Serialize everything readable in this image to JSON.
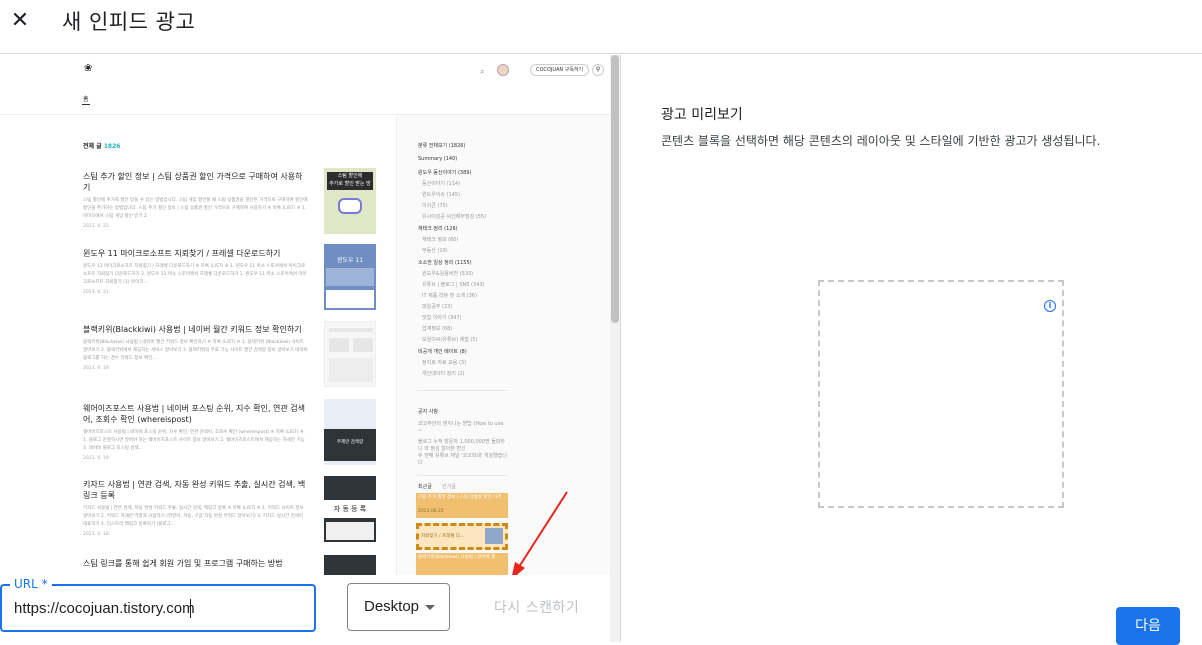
{
  "header": {
    "close_icon": "close-icon",
    "title": "새 인피드 광고"
  },
  "preview_site": {
    "logo_icon": "blog-logo-icon",
    "search_icon": "search-icon",
    "subscribe_label": "COCOJUAN 구독하기",
    "home_tab": "홈",
    "post_count_label": "전체 글",
    "post_count": "1826",
    "posts": [
      {
        "title": "스팀 추가 할인 정보 | 스팀 상품권 할인 가격으로 구매하여 사용하기",
        "excerpt": "스팀 할인에 추가로 할인 받을 수 있는 방법입니다. 스팀 게임 할인할 때 스팀 상품권을 할인된 가격으로 구매하여 할인에 할인을 추가하는 방법입니다. 스팀 추가 할인 정보 | 스팀 상품권 할인 가격으로 구매하여 사용하기 ※ 목록 (LIST) ※ 1. 이마오에서 스팀 게임 할인 받기 2.",
        "date": "2023. 6. 22."
      },
      {
        "title": "윈도우 11 마이크로소프트 지뢰찾기 / 프레셀 다운로드하기",
        "excerpt": "윈도우 11 마이크로소프트 지뢰찾기 / 프레셀 다운로드하기 ※ 목록 (LIST) ※ 1. 윈도우 11 마소 스토어에서 마이크로소프트 지뢰찾기 다운로드하기 2. 윈도우 11 마소 스토어에서 프레셀 다운로드하기 1. 윈도우 11 마소 스토어에서 마이크로소프트 지뢰찾기 (1) 마이크...",
        "date": "2023. 6. 21."
      },
      {
        "title": "블랙키위(Blackkiwi) 사용법 | 네이버 월간 키워드 정보 확인하기",
        "excerpt": "블랙키위(Blackkiwi) 사용법 | 네이버 월간 키워드 정보 확인하기 ※ 목록 (LIST) ※ 1. 블랙키위 (Blackkiwi) 사이트 알아보기 2. 블랙키위에서 제공하는 서비스 알아보기 3. 블랙키위의 무료 기능 사이트 월간 검색량 정보 알아보기 네이버 블로그를 하는 경우 키워드 정보 확인...",
        "date": "2023. 6. 19."
      },
      {
        "title": "웨어이즈포스트 사용법 | 네이버 포스팅 순위, 지수 확인, 연관 검색어, 조회수 확인 (whereispost)",
        "excerpt": "웨어이즈포스트 사용법 | 네이버 포스팅 순위, 지수 확인, 연관 검색어, 조회수 확인 (whereispost) ※ 목록 (LIST) ※ 1. 블로그 운영하시면 알아야 하는 웨어이즈포스트 사이트 정보 알아보기 2. 웨어이즈포스트에서 제공하는 자세한 기능 3. 네이버 블로그 포스팅 검색...",
        "date": "2023. 6. 19."
      },
      {
        "title": "키자드 사용법 | 연관 검색, 자동 완성 키워드 추출, 실시간 검색, 백링크 등록",
        "excerpt": "키자드 사용법 | 연관 검색, 자동 완성 키워드 추출, 실시간 검색, 백링크 등록 ※ 목록 (LIST) ※ 1. 키워드 사이트 정보 알아보기 2. 키워드 자세한 역할과 사용하기 (연관어, 자동, 구글 자동 완성 키워드 알아보기) 3. 키자드 실시간 검색어 대표하기 4. 티스토리 백링크 등록하기 (블로그...",
        "date": "2023. 6. 18."
      },
      {
        "title": "스팀 링크를 통해 쉽게 회원 가입 및 프로그램 구매하는 방법",
        "excerpt": "",
        "date": ""
      }
    ],
    "thumb_texts": [
      "스팀 할인에",
      "추가로 할인 받는 방",
      "윈도우 11",
      "자 동 등 록",
      "주제란 검색량"
    ],
    "sidebar": {
      "items": [
        {
          "label": "분류 전체보기 (1826)",
          "kind": "head"
        },
        {
          "label": "Summary (140)",
          "kind": "head"
        },
        {
          "label": "윈도우 동산이야기 (389)",
          "kind": "head"
        },
        {
          "label": "동산이야기 (114)",
          "kind": "sub"
        },
        {
          "label": "윈도우이슈 (145)",
          "kind": "sub"
        },
        {
          "label": "이이콘 (75)",
          "kind": "sub"
        },
        {
          "label": "유시이성공 씨인해무털성 (55)",
          "kind": "sub"
        },
        {
          "label": "재테크 정리 (126)",
          "kind": "head"
        },
        {
          "label": "재테크 정보 (60)",
          "kind": "sub"
        },
        {
          "label": "부동산 (19)",
          "kind": "sub"
        },
        {
          "label": "소소한 일상 정리 (1155)",
          "kind": "head"
        },
        {
          "label": "윈도우&응용버전 (533)",
          "kind": "sub"
        },
        {
          "label": "유튜브 | 블로그 | SNS (343)",
          "kind": "sub"
        },
        {
          "label": "IT 제품 리뷰 및 소개 (36)",
          "kind": "sub"
        },
        {
          "label": "파일공부 (23)",
          "kind": "sub"
        },
        {
          "label": "맛집 이야기 (347)",
          "kind": "sub"
        },
        {
          "label": "업계정보 (68)",
          "kind": "sub"
        },
        {
          "label": "모임이씨(유튜브) 체험 (5)",
          "kind": "sub"
        },
        {
          "label": "비공개 개인 메이트 (8)",
          "kind": "head"
        },
        {
          "label": "정치로 자료 모음 (3)",
          "kind": "sub"
        },
        {
          "label": "개인데이터 정리 (2)",
          "kind": "sub"
        }
      ],
      "notice_head": "공지 사항",
      "notices": [
        "코코주안의 엔지니는 방법 (How to use ~",
        "블로그 누적 방문자 1,000,000명 돌파하니 와 정성 알아본 변신",
        "두 번째 유튜브 채널 '코코피네' 개설했습니다"
      ],
      "recent_tabs": [
        "최근글",
        "인기글"
      ],
      "recent": [
        "스팀 추가 할인 정보 | 스팀 상품권 할인 가격 ...",
        "2023.06.22",
        "지뢰찾기 / 프레셀 다...",
        "블랙키위(Blackkiwi) 사용법 | 네이버 월 ..."
      ]
    }
  },
  "controls": {
    "url_label": "URL *",
    "url_value": "https://cocojuan.tistory.com",
    "device_select": "Desktop",
    "rescan_label": "다시 스캔하기"
  },
  "preview": {
    "title": "광고 미리보기",
    "description": "콘텐츠 블록을 선택하면 해당 콘텐츠의 레이아웃 및 스타일에 기반한 광고가 생성됩니다.",
    "info_icon": "info-icon"
  },
  "footer": {
    "next_label": "다음"
  },
  "colors": {
    "accent": "#1a73e8",
    "dashed_highlight": "#d08a14",
    "arrow": "#e8251c"
  }
}
